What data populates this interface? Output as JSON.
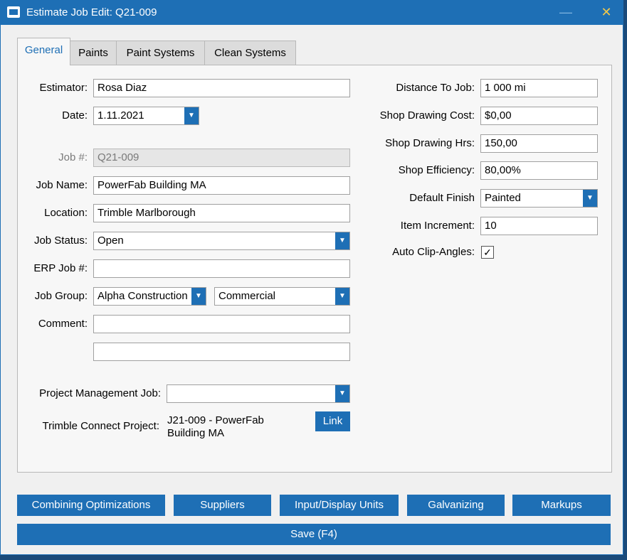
{
  "window": {
    "title": "Estimate Job Edit:  Q21-009",
    "minimize": "—",
    "close": "✕"
  },
  "tabs": [
    "General",
    "Paints",
    "Paint Systems",
    "Clean Systems"
  ],
  "left": {
    "estimator": {
      "label": "Estimator:",
      "value": "Rosa Diaz"
    },
    "date": {
      "label": "Date:",
      "value": "1.11.2021"
    },
    "job_number": {
      "label": "Job #:",
      "value": "Q21-009"
    },
    "job_name": {
      "label": "Job Name:",
      "value": "PowerFab Building MA"
    },
    "location": {
      "label": "Location:",
      "value": "Trimble Marlborough"
    },
    "job_status": {
      "label": "Job Status:",
      "value": "Open"
    },
    "erp_job": {
      "label": "ERP Job #:",
      "value": ""
    },
    "job_group": {
      "label": "Job Group:",
      "value": "Alpha Construction",
      "value2": "Commercial"
    },
    "comment": {
      "label": "Comment:",
      "value": "",
      "value2": ""
    },
    "project_management_job": {
      "label": "Project Management Job:",
      "value": ""
    },
    "trimble_connect": {
      "label": "Trimble Connect Project:",
      "line1": "J21-009 - PowerFab",
      "line2": "Building MA",
      "link_label": "Link"
    }
  },
  "right": {
    "distance_to_job": {
      "label": "Distance To Job:",
      "value": "1 000 mi"
    },
    "shop_drawing_cost": {
      "label": "Shop Drawing Cost:",
      "value": "$0,00"
    },
    "shop_drawing_hrs": {
      "label": "Shop Drawing Hrs:",
      "value": "150,00"
    },
    "shop_efficiency": {
      "label": "Shop Efficiency:",
      "value": "80,00%"
    },
    "default_finish": {
      "label": "Default Finish",
      "value": "Painted"
    },
    "item_increment": {
      "label": "Item Increment:",
      "value": "10"
    },
    "auto_clip_angles": {
      "label": "Auto Clip-Angles:",
      "checked": "✓"
    }
  },
  "bottom_buttons": [
    "Combining Optimizations",
    "Suppliers",
    "Input/Display Units",
    "Galvanizing",
    "Markups"
  ],
  "save_label": "Save (F4)",
  "icons": {
    "dropdown": "chevron-down-icon",
    "app": "app-icon"
  },
  "colors": {
    "accent": "#1e6fb5",
    "panel": "#f7f7f7",
    "window": "#f0f0f0"
  }
}
